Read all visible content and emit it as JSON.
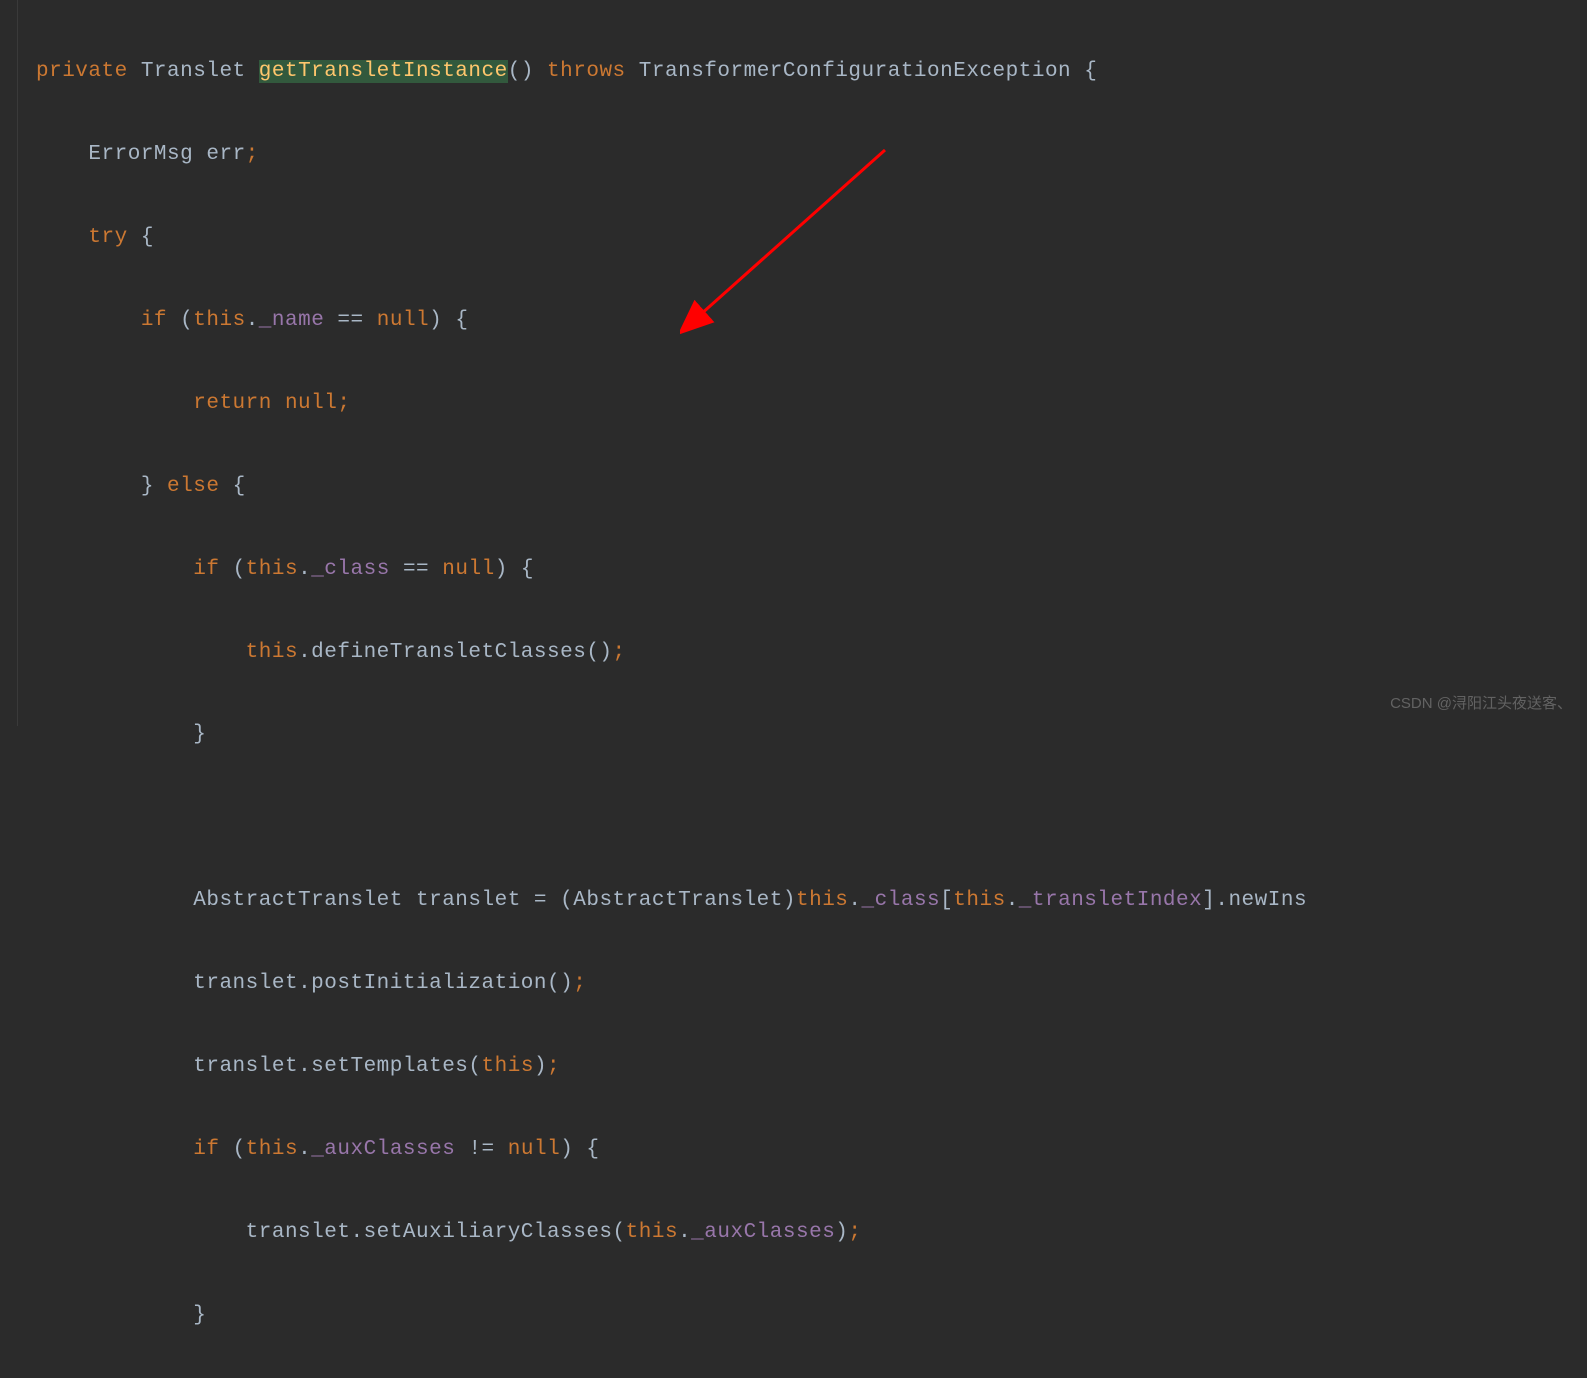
{
  "code": {
    "line1": {
      "private": "private",
      "type": "Translet",
      "method": "getTransletInstance",
      "parens": "()",
      "throws": "throws",
      "exception": "TransformerConfigurationException",
      "brace": "{"
    },
    "line2": {
      "type": "ErrorMsg",
      "var": "err",
      "semi": ";"
    },
    "line3": {
      "try": "try",
      "brace": "{"
    },
    "line4": {
      "if": "if",
      "open": "(",
      "this": "this",
      "dot": ".",
      "field": "_name",
      "op": "==",
      "null": "null",
      "close": ")",
      "brace": "{"
    },
    "line5": {
      "return": "return null",
      "semi": ";"
    },
    "line6": {
      "close": "}",
      "else": "else",
      "brace": "{"
    },
    "line7": {
      "if": "if",
      "open": "(",
      "this": "this",
      "dot": ".",
      "field": "_class",
      "op": "==",
      "null": "null",
      "close": ")",
      "brace": "{"
    },
    "line8": {
      "this": "this",
      "dot": ".",
      "method": "defineTransletClasses",
      "parens": "()",
      "semi": ";"
    },
    "line9": {
      "close": "}"
    },
    "line11": {
      "type": "AbstractTranslet",
      "var": "translet",
      "eq": "=",
      "cast_open": "(",
      "cast_type": "AbstractTranslet",
      "cast_close": ")",
      "this1": "this",
      "dot1": ".",
      "field1": "_class",
      "bracket_open": "[",
      "this2": "this",
      "dot2": ".",
      "field2": "_transletIndex",
      "bracket_close": "]",
      "dot3": ".",
      "method": "newIns"
    },
    "line12": {
      "var": "translet",
      "dot": ".",
      "method": "postInitialization",
      "parens": "()",
      "semi": ";"
    },
    "line13": {
      "var": "translet",
      "dot": ".",
      "method": "setTemplates",
      "open": "(",
      "this": "this",
      "close": ")",
      "semi": ";"
    },
    "line14": {
      "if": "if",
      "open": "(",
      "this": "this",
      "dot": ".",
      "field": "_auxClasses",
      "op": "!=",
      "null": "null",
      "close": ")",
      "brace": "{"
    },
    "line15": {
      "var": "translet",
      "dot": ".",
      "method": "setAuxiliaryClasses",
      "open": "(",
      "this": "this",
      "dot2": ".",
      "field": "_auxClasses",
      "close": ")",
      "semi": ";"
    },
    "line16": {
      "close": "}"
    }
  },
  "watermark": "CSDN @浔阳江头夜送客、"
}
